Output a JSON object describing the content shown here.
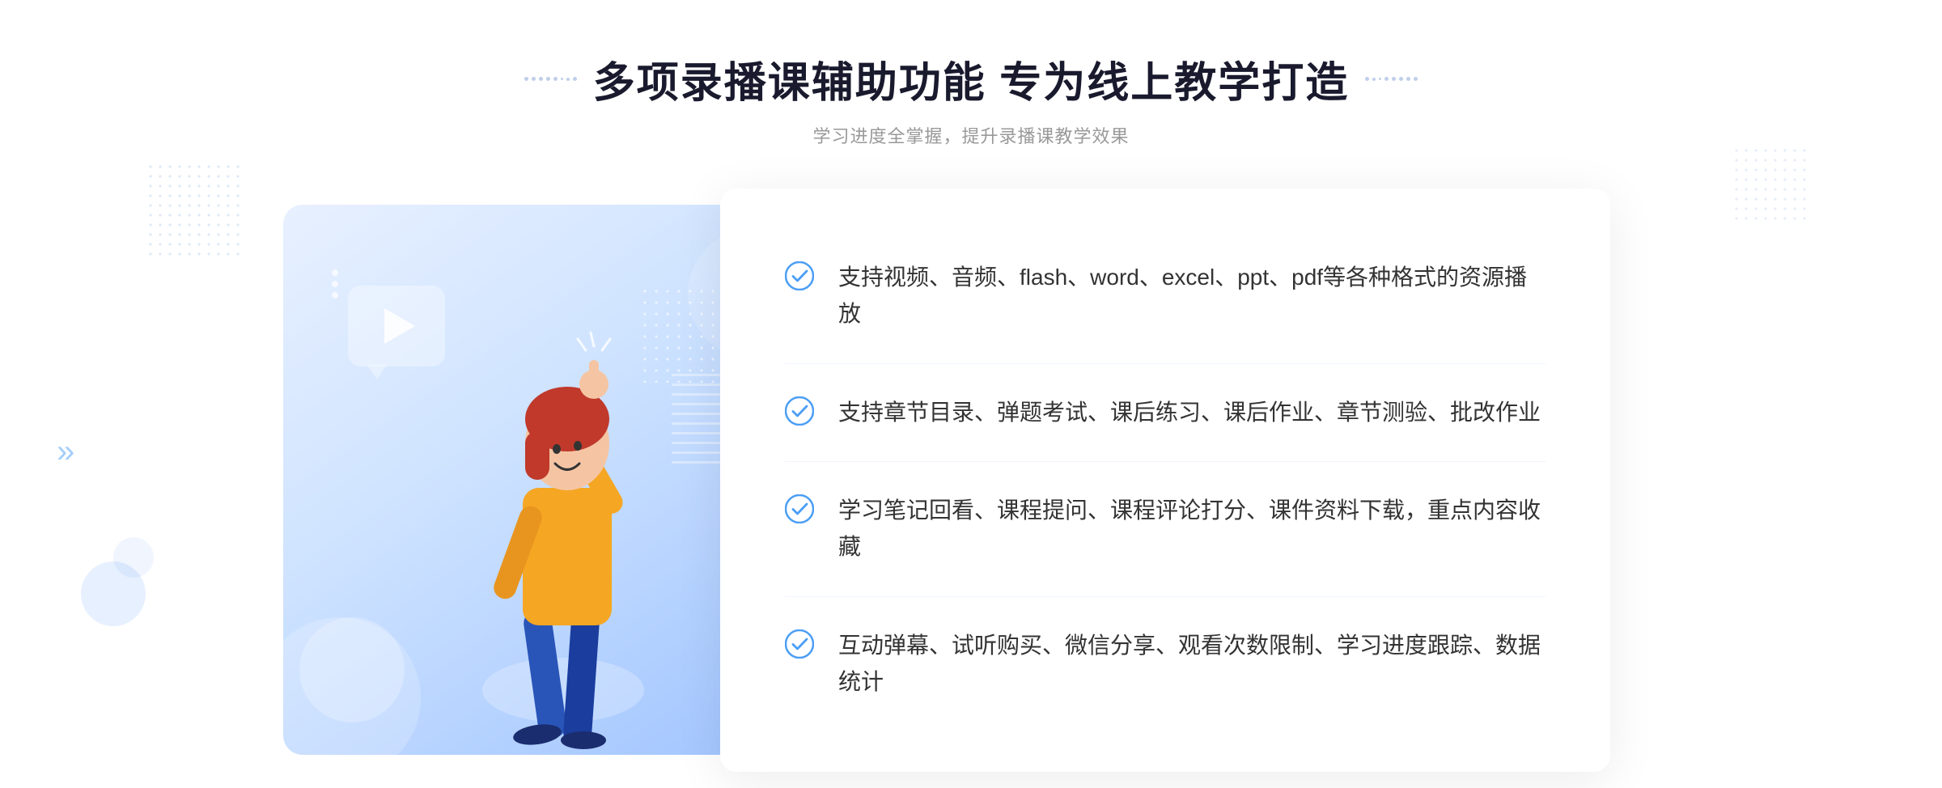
{
  "header": {
    "title": "多项录播课辅助功能 专为线上教学打造",
    "subtitle": "学习进度全掌握，提升录播课教学效果"
  },
  "features": [
    {
      "id": 1,
      "text": "支持视频、音频、flash、word、excel、ppt、pdf等各种格式的资源播放"
    },
    {
      "id": 2,
      "text": "支持章节目录、弹题考试、课后练习、课后作业、章节测验、批改作业"
    },
    {
      "id": 3,
      "text": "学习笔记回看、课程提问、课程评论打分、课件资料下载，重点内容收藏"
    },
    {
      "id": 4,
      "text": "互动弹幕、试听购买、微信分享、观看次数限制、学习进度跟踪、数据统计"
    }
  ],
  "decoration": {
    "arrow_left": "»",
    "dots_pattern": "···"
  }
}
